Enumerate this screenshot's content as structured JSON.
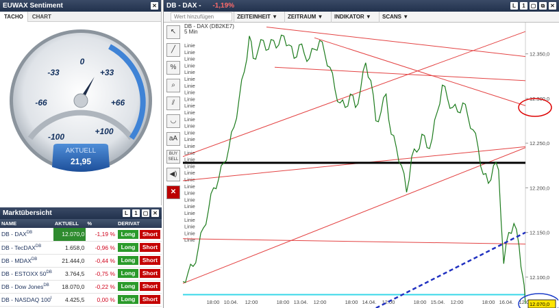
{
  "euwax": {
    "title": "EUWAX Sentiment",
    "tabs": [
      "TACHO",
      "CHART"
    ],
    "scale": [
      "-100",
      "-66",
      "-33",
      "0",
      "+33",
      "+66",
      "+100"
    ],
    "aktuell_label": "AKTUELL",
    "aktuell_value": "21,95",
    "sentiment": 21.95
  },
  "market": {
    "title": "Marktübersicht",
    "columns": [
      "NAME",
      "AKTUELL",
      "%",
      "DERIVAT"
    ],
    "rows": [
      {
        "name": "DB - DAX",
        "sup": "DB",
        "value": "12.070,0",
        "pct": "-1,19 %",
        "long": "Long",
        "short": "Short"
      },
      {
        "name": "DB - TecDAX",
        "sup": "DB",
        "value": "1.658,0",
        "pct": "-0,96 %",
        "long": "Long",
        "short": "Short"
      },
      {
        "name": "DB - MDAX",
        "sup": "DB",
        "value": "21.444,0",
        "pct": "-0,44 %",
        "long": "Long",
        "short": "Short"
      },
      {
        "name": "DB - ESTOXX 50",
        "sup": "DB",
        "value": "3.764,5",
        "pct": "-0,75 %",
        "long": "Long",
        "short": "Short"
      },
      {
        "name": "DB - Dow Jones",
        "sup": "DB",
        "value": "18.070,0",
        "pct": "-0,22 %",
        "long": "Long",
        "short": "Short"
      },
      {
        "name": "DB - NASDAQ 100",
        "sup": "I",
        "value": "4.425,5",
        "pct": "0,00 %",
        "long": "Long",
        "short": "Short"
      }
    ]
  },
  "chart": {
    "title": "DB - DAX -",
    "change": "-1,19%",
    "search_placeholder": "Wert hinzufügen",
    "menus": [
      "ZEITEINHEIT",
      "ZEITRAUM",
      "INDIKATOR",
      "SCANS"
    ],
    "instrument": "DB - DAX (DB2KE7)",
    "interval": "5 Min",
    "line_label": "Linie",
    "last_price": "12.070,0"
  },
  "chart_data": {
    "type": "line",
    "y_ticks": [
      "12.350,0",
      "12.300,0",
      "12.250,0",
      "12.200,0",
      "12.150,0",
      "12.100,0"
    ],
    "y_tick_values": [
      12350,
      12300,
      12250,
      12200,
      12150,
      12100
    ],
    "ylim": [
      12080,
      12385
    ],
    "x_ticks": [
      "18:00",
      "10.04.",
      "12:00",
      "18:00",
      "13.04.",
      "12:00",
      "18:00",
      "14.04.",
      "12:00",
      "18:00",
      "15.04.",
      "12:00",
      "18:00",
      "16.04.",
      "12:00"
    ],
    "price_path": [
      [
        0,
        12095
      ],
      [
        8,
        12105
      ],
      [
        16,
        12112
      ],
      [
        24,
        12132
      ],
      [
        32,
        12155
      ],
      [
        40,
        12175
      ],
      [
        48,
        12200
      ],
      [
        56,
        12210
      ],
      [
        64,
        12228
      ],
      [
        72,
        12245
      ],
      [
        80,
        12268
      ],
      [
        88,
        12300
      ],
      [
        96,
        12330
      ],
      [
        104,
        12370
      ],
      [
        110,
        12345
      ],
      [
        118,
        12355
      ],
      [
        126,
        12365
      ],
      [
        134,
        12355
      ],
      [
        142,
        12365
      ],
      [
        150,
        12360
      ],
      [
        158,
        12370
      ],
      [
        166,
        12360
      ],
      [
        174,
        12345
      ],
      [
        182,
        12360
      ],
      [
        190,
        12350
      ],
      [
        198,
        12345
      ],
      [
        206,
        12355
      ],
      [
        214,
        12365
      ],
      [
        222,
        12350
      ],
      [
        230,
        12335
      ],
      [
        238,
        12310
      ],
      [
        246,
        12295
      ],
      [
        254,
        12290
      ],
      [
        262,
        12305
      ],
      [
        270,
        12290
      ],
      [
        278,
        12310
      ],
      [
        286,
        12340
      ],
      [
        294,
        12320
      ],
      [
        302,
        12275
      ],
      [
        310,
        12285
      ],
      [
        318,
        12305
      ],
      [
        326,
        12260
      ],
      [
        334,
        12245
      ],
      [
        342,
        12225
      ],
      [
        350,
        12195
      ],
      [
        358,
        12235
      ],
      [
        366,
        12240
      ],
      [
        374,
        12260
      ],
      [
        382,
        12245
      ],
      [
        390,
        12255
      ],
      [
        398,
        12285
      ],
      [
        406,
        12315
      ],
      [
        414,
        12300
      ],
      [
        422,
        12290
      ],
      [
        430,
        12285
      ],
      [
        438,
        12295
      ],
      [
        446,
        12280
      ],
      [
        454,
        12265
      ],
      [
        462,
        12245
      ],
      [
        470,
        12215
      ],
      [
        478,
        12205
      ],
      [
        486,
        12225
      ],
      [
        494,
        12220
      ],
      [
        502,
        12115
      ],
      [
        510,
        12150
      ],
      [
        518,
        12160
      ],
      [
        526,
        12135
      ],
      [
        532,
        12100
      ],
      [
        536,
        12070
      ]
    ],
    "support_level": 12228,
    "last_price": 12070
  }
}
